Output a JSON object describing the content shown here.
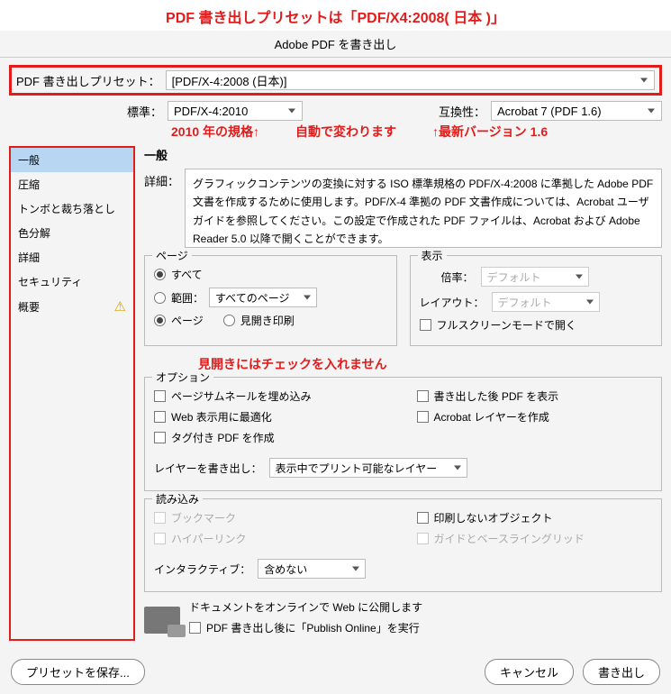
{
  "annotation_top": "PDF 書き出しプリセットは「PDF/X4:2008( 日本 )」",
  "title": "Adobe PDF を書き出し",
  "preset": {
    "label": "PDF 書き出しプリセット：",
    "value": "[PDF/X-4:2008 (日本)]"
  },
  "standard": {
    "label": "標準：",
    "value": "PDF/X-4:2010"
  },
  "compat": {
    "label": "互換性：",
    "value": "Acrobat 7 (PDF 1.6)"
  },
  "anno_row": {
    "a": "2010 年の規格↑",
    "b": "自動で変わります",
    "c": "↑最新バージョン 1.6"
  },
  "sidebar": {
    "items": [
      "一般",
      "圧縮",
      "トンボと裁ち落とし",
      "色分解",
      "詳細",
      "セキュリティ",
      "概要"
    ]
  },
  "panel_title": "一般",
  "detail": {
    "label": "詳細：",
    "text": "グラフィックコンテンツの変換に対する ISO 標準規格の PDF/X-4:2008 に準拠した Adobe PDF 文書を作成するために使用します。PDF/X-4 準拠の PDF 文書作成については、Acrobat ユーザガイドを参照してください。この設定で作成された PDF ファイルは、Acrobat および Adobe Reader 5.0 以降で開くことができます。"
  },
  "pages": {
    "title": "ページ",
    "all": "すべて",
    "range": "範囲：",
    "range_value": "すべてのページ",
    "page": "ページ",
    "spread": "見開き印刷"
  },
  "display": {
    "title": "表示",
    "zoom_label": "倍率：",
    "zoom_value": "デフォルト",
    "layout_label": "レイアウト：",
    "layout_value": "デフォルト",
    "fullscreen": "フルスクリーンモードで開く"
  },
  "anno_spread": "見開きにはチェックを入れません",
  "options": {
    "title": "オプション",
    "thumb": "ページサムネールを埋め込み",
    "showafter": "書き出した後 PDF を表示",
    "web": "Web 表示用に最適化",
    "acrobat_layer": "Acrobat レイヤーを作成",
    "tagged": "タグ付き PDF を作成",
    "layers_label": "レイヤーを書き出し：",
    "layers_value": "表示中でプリント可能なレイヤー"
  },
  "import": {
    "title": "読み込み",
    "bookmark": "ブックマーク",
    "noprint": "印刷しないオブジェクト",
    "hyperlink": "ハイパーリンク",
    "guides": "ガイドとベースライングリッド",
    "interactive_label": "インタラクティブ：",
    "interactive_value": "含めない"
  },
  "publish": {
    "line1": "ドキュメントをオンラインで Web に公開します",
    "line2": "PDF 書き出し後に「Publish Online」を実行"
  },
  "footer": {
    "save": "プリセットを保存...",
    "cancel": "キャンセル",
    "export": "書き出し"
  }
}
